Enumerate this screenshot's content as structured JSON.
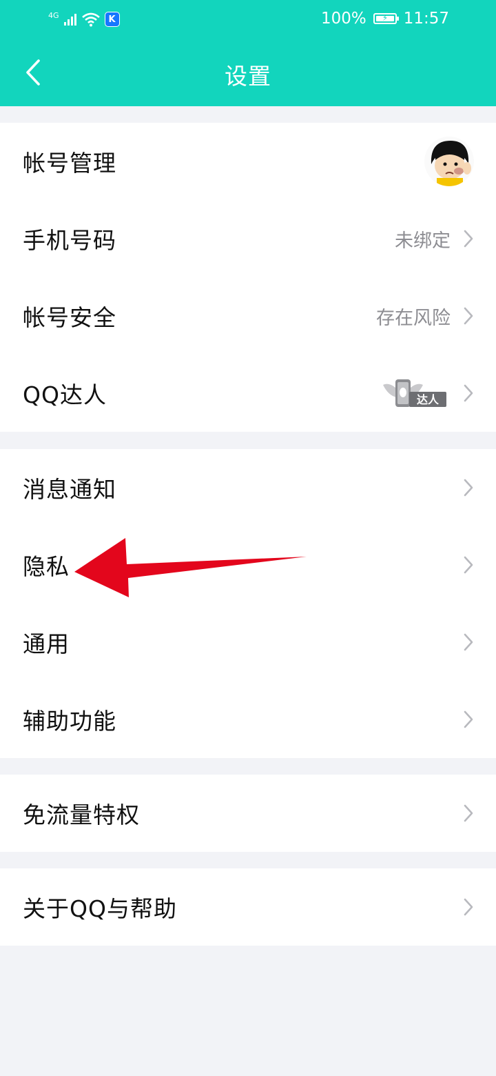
{
  "status_bar": {
    "network": "4G",
    "battery": "100%",
    "time": "11:57",
    "k_badge": "K"
  },
  "header": {
    "title": "设置",
    "back_icon": "chevron-left-icon"
  },
  "groups": [
    {
      "items": [
        {
          "label": "帐号管理",
          "value": ""
        },
        {
          "label": "手机号码",
          "value": "未绑定"
        },
        {
          "label": "帐号安全",
          "value": "存在风险"
        },
        {
          "label": "QQ达人",
          "value": "",
          "badge": "达人"
        }
      ]
    },
    {
      "items": [
        {
          "label": "消息通知",
          "value": ""
        },
        {
          "label": "隐私",
          "value": ""
        },
        {
          "label": "通用",
          "value": ""
        },
        {
          "label": "辅助功能",
          "value": ""
        }
      ]
    },
    {
      "items": [
        {
          "label": "免流量特权",
          "value": ""
        }
      ]
    },
    {
      "items": [
        {
          "label": "关于QQ与帮助",
          "value": ""
        }
      ]
    }
  ],
  "colors": {
    "header": "#12d5bd",
    "background": "#f2f3f7",
    "annotation_arrow": "#e3061c"
  }
}
